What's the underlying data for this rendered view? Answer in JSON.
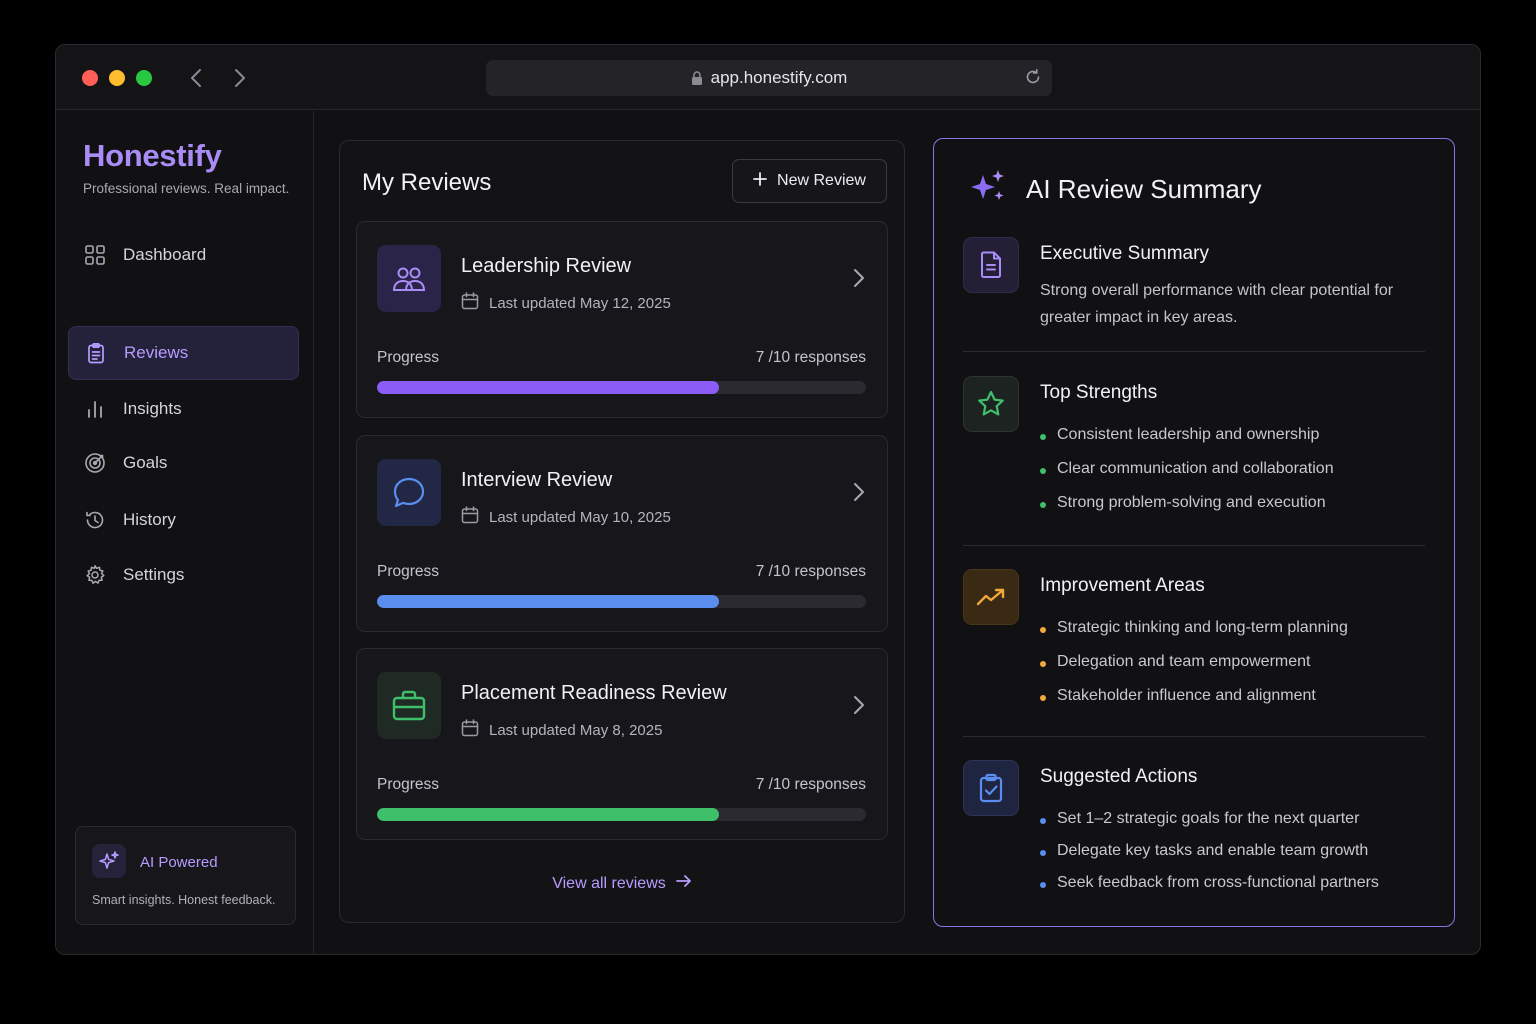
{
  "browser": {
    "url": "app.honestify.com"
  },
  "sidebar": {
    "brand": "Honestify",
    "tagline": "Professional reviews. Real impact.",
    "items": [
      {
        "label": "Dashboard",
        "icon": "grid-icon"
      },
      {
        "label": "Reviews",
        "icon": "clipboard-icon",
        "active": true
      },
      {
        "label": "Insights",
        "icon": "bar-chart-icon"
      },
      {
        "label": "Goals",
        "icon": "target-icon"
      },
      {
        "label": "History",
        "icon": "history-icon"
      },
      {
        "label": "Settings",
        "icon": "gear-icon"
      }
    ],
    "ai_card": {
      "title": "AI Powered",
      "subtitle": "Smart insights. Honest feedback."
    }
  },
  "reviews": {
    "title": "My Reviews",
    "new_button": "New Review",
    "progress_label": "Progress",
    "items": [
      {
        "title": "Leadership Review",
        "date": "Last updated May 12, 2025",
        "responses": "7 /10 responses",
        "progress": 0.7,
        "color": "#8b5cf6",
        "icon": "users-icon"
      },
      {
        "title": "Interview Review",
        "date": "Last updated May 10, 2025",
        "responses": "7 /10 responses",
        "progress": 0.7,
        "color": "#5b8def",
        "icon": "chat-bubble-icon"
      },
      {
        "title": "Placement Readiness Review",
        "date": "Last updated May 8, 2025",
        "responses": "7 /10 responses",
        "progress": 0.7,
        "color": "#3fbf6a",
        "icon": "briefcase-icon"
      }
    ],
    "view_all": "View all reviews"
  },
  "summary": {
    "title": "AI Review Summary",
    "executive": {
      "title": "Executive Summary",
      "body": "Strong overall performance with clear potential for greater impact in key areas."
    },
    "strengths": {
      "title": "Top Strengths",
      "items": [
        "Consistent leadership and ownership",
        "Clear communication and collaboration",
        "Strong problem-solving and execution"
      ]
    },
    "improvements": {
      "title": "Improvement Areas",
      "items": [
        "Strategic thinking and long-term planning",
        "Delegation and team empowerment",
        "Stakeholder influence and alignment"
      ]
    },
    "actions": {
      "title": "Suggested Actions",
      "items": [
        "Set 1–2 strategic goals for the next quarter",
        "Delegate key tasks and enable team growth",
        "Seek feedback from cross-functional partners"
      ]
    }
  }
}
